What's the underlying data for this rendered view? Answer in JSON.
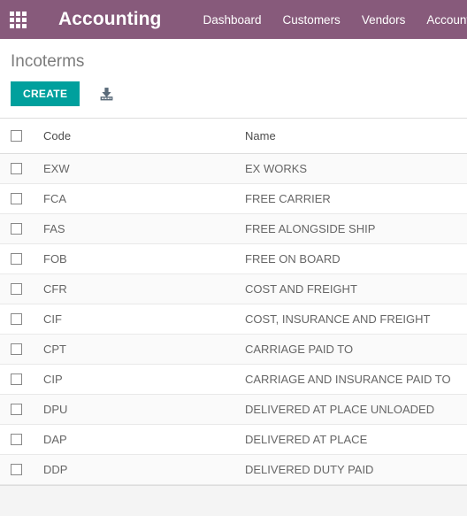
{
  "navbar": {
    "apps_icon": "grid-apps-icon",
    "brand": "Accounting",
    "links": [
      {
        "label": "Dashboard"
      },
      {
        "label": "Customers"
      },
      {
        "label": "Vendors"
      },
      {
        "label": "Accounting"
      }
    ],
    "color": "#875A7B"
  },
  "control_panel": {
    "breadcrumb": "Incoterms",
    "create_label": "CREATE",
    "create_color": "#00A09D",
    "import_icon": "import-download-icon"
  },
  "list": {
    "select_all_icon": "checkbox-unchecked-icon",
    "columns": [
      {
        "label": "Code"
      },
      {
        "label": "Name"
      }
    ],
    "rows": [
      {
        "code": "EXW",
        "name": "EX WORKS"
      },
      {
        "code": "FCA",
        "name": "FREE CARRIER"
      },
      {
        "code": "FAS",
        "name": "FREE ALONGSIDE SHIP"
      },
      {
        "code": "FOB",
        "name": "FREE ON BOARD"
      },
      {
        "code": "CFR",
        "name": "COST AND FREIGHT"
      },
      {
        "code": "CIF",
        "name": "COST, INSURANCE AND FREIGHT"
      },
      {
        "code": "CPT",
        "name": "CARRIAGE PAID TO"
      },
      {
        "code": "CIP",
        "name": "CARRIAGE AND INSURANCE PAID TO"
      },
      {
        "code": "DPU",
        "name": "DELIVERED AT PLACE UNLOADED"
      },
      {
        "code": "DAP",
        "name": "DELIVERED AT PLACE"
      },
      {
        "code": "DDP",
        "name": "DELIVERED DUTY PAID"
      }
    ]
  }
}
